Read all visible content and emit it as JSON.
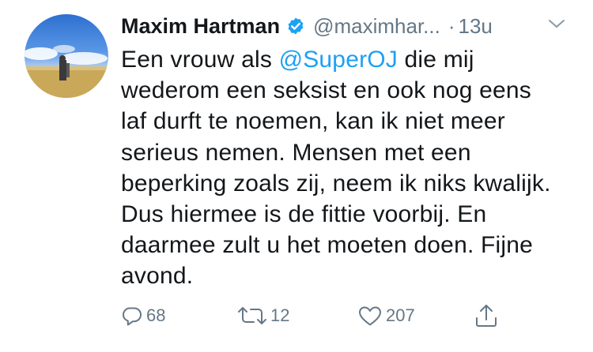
{
  "tweet": {
    "author_name": "Maxim Hartman",
    "handle": "@maximhar...",
    "separator": "·",
    "time": "13u",
    "lines": [
      {
        "before": "Een vrouw als ",
        "mention": "@SuperOJ",
        "after": " die mij"
      },
      {
        "text": "wederom een seksist en ook nog eens"
      },
      {
        "text": "laf durft te noemen, kan ik niet meer"
      },
      {
        "text": "serieus nemen. Mensen met een"
      },
      {
        "text": "beperking zoals zij, neem ik niks kwalijk."
      },
      {
        "text": "Dus hiermee is de fittie voorbij. En"
      },
      {
        "text": "daarmee zult u het moeten doen. Fijne"
      },
      {
        "text": "avond."
      }
    ],
    "icons": {
      "verified": "verified-badge-icon",
      "menu": "chevron-down-icon",
      "reply": "speech-bubble-icon",
      "retweet": "retweet-arrows-icon",
      "like": "heart-icon",
      "share": "share-upload-icon"
    },
    "actions": {
      "reply_count": "68",
      "retweet_count": "12",
      "like_count": "207"
    }
  },
  "colors": {
    "text": "#14171a",
    "secondary": "#657786",
    "link": "#1da1f2",
    "verified": "#1da1f2"
  }
}
